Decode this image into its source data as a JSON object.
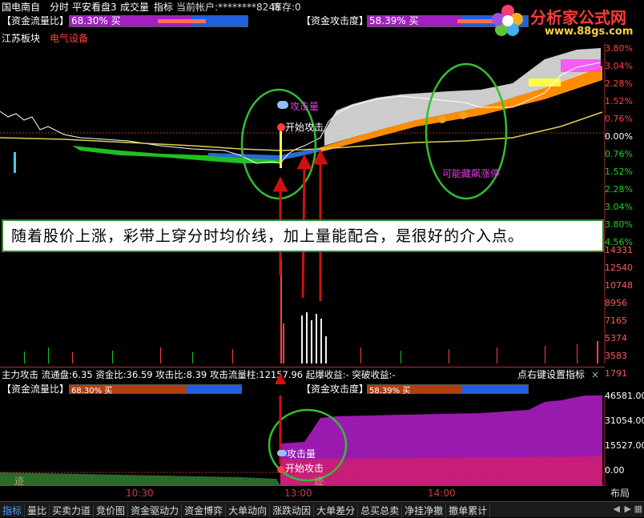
{
  "header": {
    "stock": "国电南自",
    "items": [
      "分时",
      "平安看盘3",
      "成交量",
      "指标",
      "当前帐户:********8248",
      "库存:0"
    ]
  },
  "indicators": {
    "flow_ratio": {
      "label": "【资金流量比】",
      "value": "68.30% 买",
      "pct": 68.3
    },
    "attack": {
      "label": "【资金攻击度】",
      "value": "58.39% 买",
      "pct": 58.39
    }
  },
  "sector": {
    "board": "江苏板块",
    "industry": "电气设备"
  },
  "right_axis": {
    "pct": [
      "3.80%",
      "3.04%",
      "2.28%",
      "1.52%",
      "0.76%",
      "0.00%",
      "0.76%",
      "1.52%",
      "2.28%",
      "3.04%",
      "3.80%",
      "4.56%"
    ],
    "vol": [
      "14331",
      "12540",
      "10748",
      "8956",
      "7165",
      "5374",
      "3583",
      "1791"
    ],
    "lower": [
      "46581.00",
      "31054.00",
      "15527.00",
      "0.00"
    ]
  },
  "annotations": {
    "attack_volume": "攻击量",
    "start_attack": "开始攻击",
    "may_limit_up": "可能藏飙涨停",
    "trace": "迹"
  },
  "callout": "随着股价上涨，彩带上穿分时均价线，加上量能配合，是很好的介入点。",
  "watermark": {
    "brand": "分析家公式网",
    "url": "www.88gs.com"
  },
  "lower_panel": {
    "stats": "主力攻击  流通盘:6.35  资金比:36.59  攻击比:8.39  攻击流量柱:12157.96  起爆收益:-  突破收益:-",
    "right_hint": "点右键设置指标",
    "close": "×"
  },
  "time_axis": [
    "10:30",
    "13:00",
    "14:00"
  ],
  "layout_btn": "布局",
  "tabs": [
    "指标",
    "量比",
    "买卖力道",
    "竞价图",
    "资金驱动力",
    "资金博弈",
    "大单动向",
    "涨跌动因",
    "大单差分",
    "总买总卖",
    "净挂净撤",
    "撤单累计"
  ],
  "colors": {
    "up": "#ff3030",
    "down": "#20c020",
    "band": "#ff8c00",
    "avg": "#e0d050",
    "purple": "#9a1ab0"
  }
}
